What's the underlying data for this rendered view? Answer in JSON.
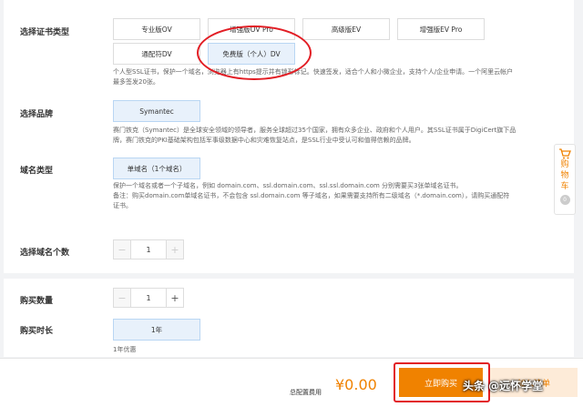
{
  "cert_type": {
    "label": "选择证书类型",
    "options": [
      "专业版OV",
      "增强版OV Pro",
      "高级版EV",
      "增强版EV Pro",
      "通配符DV",
      "免费版（个人）DV"
    ],
    "selected": "免费版（个人）DV",
    "desc_line1": "个人型SSL证书，保护一个域名，浏览器上有https提示并有锁形标记。快速签发，适合个人和小微企业，支持个人/企业申请。一个阿里云帐户",
    "desc_line2": "最多签发20张。"
  },
  "brand": {
    "label": "选择品牌",
    "option": "Symantec",
    "desc_line1": "赛门铁克（Symantec）是全球安全领域的领导者，服务全球超过35个国家，拥有众多企业、政府和个人用户。其SSL证书属于DigiCert旗下品",
    "desc_line2": "牌，赛门铁克的PKI基础架构包括军事级数据中心和灾难恢复站点，是SSL行业中受认可和值得信赖的品牌。"
  },
  "domain_type": {
    "label": "域名类型",
    "option": "单域名（1个域名）",
    "desc_line1": "保护一个域名或者一个子域名，例如 domain.com、ssl.domain.com、ssl.ssl.domain.com 分别需要买3张单域名证书。",
    "desc_line2": "备注：购买domain.com单域名证书，不会包含 ssl.domain.com 等子域名，如果需要支持所有二级域名（*.domain.com），请购买通配符",
    "desc_line3": "证书。"
  },
  "domain_count": {
    "label": "选择域名个数",
    "minus": "−",
    "value": "1",
    "plus": "+"
  },
  "purchase_qty": {
    "label": "购买数量",
    "minus": "−",
    "value": "1",
    "plus": "+"
  },
  "duration": {
    "label": "购买时长",
    "option": "1年",
    "note": "1年优惠"
  },
  "cart_tab": {
    "text": "购物车",
    "count": "0",
    "icon": "cart-icon"
  },
  "footer": {
    "total_label": "总配置费用",
    "total_price": "¥0.00",
    "buy_label": "立即购买",
    "cart_label": "加入清单"
  },
  "watermark": "头条 @远怀学堂",
  "colors": {
    "accent": "#f08200",
    "selected_bg": "#e8f1fb",
    "annotation": "#e21d24"
  }
}
